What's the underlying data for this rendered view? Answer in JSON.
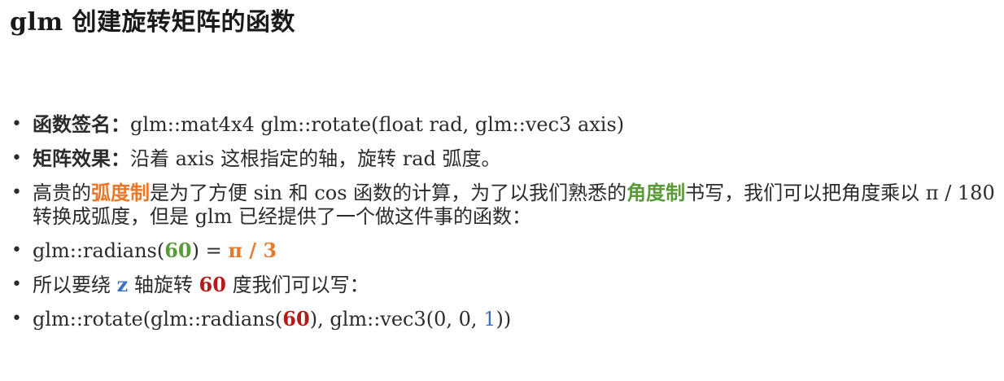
{
  "title": "glm 创建旋转矩阵的函数",
  "colors": {
    "orange": "#e8792b",
    "green": "#5a9a3a",
    "red": "#b31b1b",
    "blue": "#3b6fc4"
  },
  "bullets": {
    "b1": {
      "label": "函数签名：",
      "text": "glm::mat4x4 glm::rotate(float rad, glm::vec3 axis)"
    },
    "b2": {
      "label": "矩阵效果：",
      "text": "沿着 axis 这根指定的轴，旋转 rad 弧度。"
    },
    "b3": {
      "p1": "高贵的",
      "hl1": "弧度制",
      "p2": "是为了方便 sin 和 cos 函数的计算，为了以我们熟悉的",
      "hl2": "角度制",
      "p3": "书写，我们可以把角度乘以 π / 180 转换成弧度，但是 glm 已经提供了一个做这件事的函数："
    },
    "b4": {
      "p1": "glm::radians(",
      "num": "60",
      "p2": ") = ",
      "result": "π / 3"
    },
    "b5": {
      "p1": "所以要绕 ",
      "axis": "z",
      "p2": " 轴旋转 ",
      "num": "60",
      "p3": " 度我们可以写："
    },
    "b6": {
      "p1": "glm::rotate(glm::radians(",
      "num": "60",
      "p2": "), glm::vec3(0, 0, ",
      "one": "1",
      "p3": "))"
    }
  }
}
